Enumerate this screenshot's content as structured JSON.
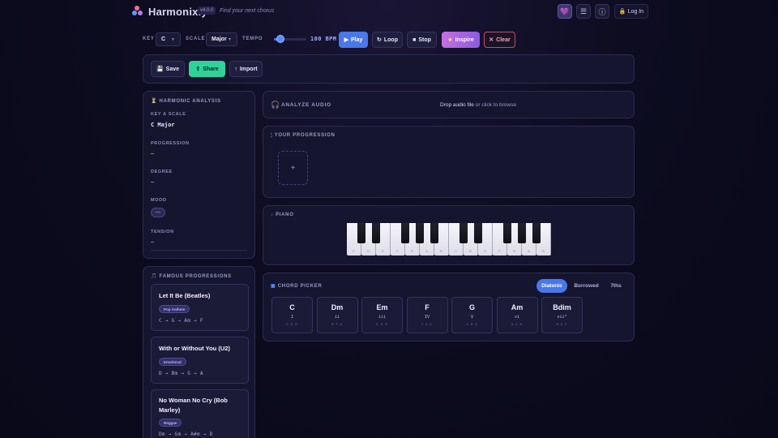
{
  "app": {
    "name": "Harmonixly",
    "version": "v4.0.0",
    "tagline": "Find your next chorus",
    "login_label": "Log In"
  },
  "header_icons": [
    "heart-icon",
    "menu-icon",
    "info-icon"
  ],
  "controls": {
    "key_label": "KEY",
    "key_value": "C",
    "scale_label": "SCALE",
    "scale_value": "Major",
    "tempo_label": "TEMPO",
    "tempo_value": 100,
    "tempo_display": "100 BPM",
    "tempo_fraction": 0.2,
    "play": "Play",
    "loop": "Loop",
    "stop": "Stop",
    "inspire": "Inspire",
    "clear": "Clear"
  },
  "actions": {
    "save": "Save",
    "share": "Share",
    "import": "Import"
  },
  "analysis": {
    "title": "HARMONIC ANALYSIS",
    "key_scale_label": "KEY & SCALE",
    "key_scale_value": "C Major",
    "progression_label": "PROGRESSION",
    "progression_value": "—",
    "degree_label": "DEGREE",
    "degree_value": "—",
    "mood_label": "MOOD",
    "mood_value": "—",
    "tension_label": "TENSION",
    "tension_value": "—"
  },
  "analyze_audio": {
    "title": "ANALYZE AUDIO",
    "drop_bold": "Drop audio file",
    "drop_rest": " or click to browse"
  },
  "progression": {
    "title": "YOUR PROGRESSION",
    "add": "+"
  },
  "piano": {
    "title": "PIANO",
    "white_keys": [
      "C",
      "D",
      "E",
      "F",
      "G",
      "A",
      "B",
      "C",
      "D",
      "E",
      "F",
      "G",
      "A",
      "B"
    ]
  },
  "famous": {
    "title": "FAMOUS PROGRESSIONS",
    "items": [
      {
        "title": "Let It Be (Beatles)",
        "tag": "Pop Anthem",
        "progression": "C → G → Am → F"
      },
      {
        "title": "With or Without You (U2)",
        "tag": "Emotional",
        "progression": "D → Bm → G → A"
      },
      {
        "title": "No Woman No Cry (Bob Marley)",
        "tag": "Reggae",
        "progression": "Dm → Gm → A#m → D"
      }
    ]
  },
  "chord_picker": {
    "title": "CHORD PICKER",
    "tabs": [
      "Diatonic",
      "Borrowed",
      "7ths"
    ],
    "active_tab": "Diatonic",
    "chords": [
      {
        "name": "C",
        "roman": "I",
        "notes": "C E G"
      },
      {
        "name": "Dm",
        "roman": "ii",
        "notes": "D F A"
      },
      {
        "name": "Em",
        "roman": "iii",
        "notes": "E G B"
      },
      {
        "name": "F",
        "roman": "IV",
        "notes": "F A C"
      },
      {
        "name": "G",
        "roman": "V",
        "notes": "G B D"
      },
      {
        "name": "Am",
        "roman": "vi",
        "notes": "A C E"
      },
      {
        "name": "Bdim",
        "roman": "vii°",
        "notes": "B D F"
      }
    ]
  },
  "colors": {
    "accent": "#4a78ea",
    "share": "#2fd39a",
    "inspire": "#b46ae2",
    "clear": "#c0506a"
  }
}
